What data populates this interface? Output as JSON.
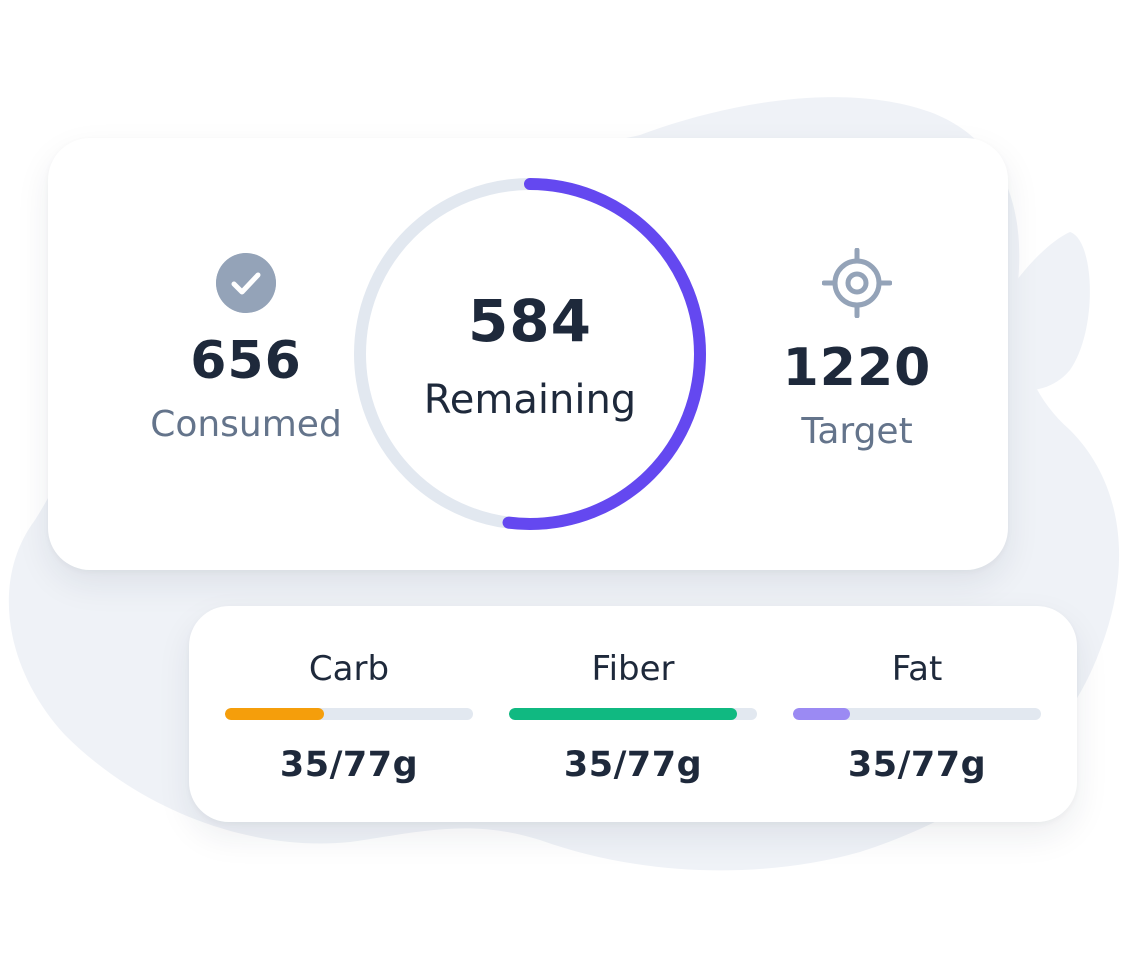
{
  "summary": {
    "consumed": {
      "value": "656",
      "label": "Consumed",
      "icon": "check-circle-icon"
    },
    "remaining": {
      "value": "584",
      "label": "Remaining",
      "progress": 0.52
    },
    "target": {
      "value": "1220",
      "label": "Target",
      "icon": "target-icon"
    }
  },
  "macros": [
    {
      "name": "Carb",
      "amount": "35/77g",
      "progress": 0.4,
      "color": "#F59E0B"
    },
    {
      "name": "Fiber",
      "amount": "35/77g",
      "progress": 0.92,
      "color": "#10B981"
    },
    {
      "name": "Fat",
      "amount": "35/77g",
      "progress": 0.23,
      "color": "#9B8AF3"
    }
  ],
  "colors": {
    "ring_progress": "#6448F0",
    "ring_track": "#E2E8F0",
    "background_blob": "#EFF2F7",
    "icon": "#94A3B8"
  }
}
